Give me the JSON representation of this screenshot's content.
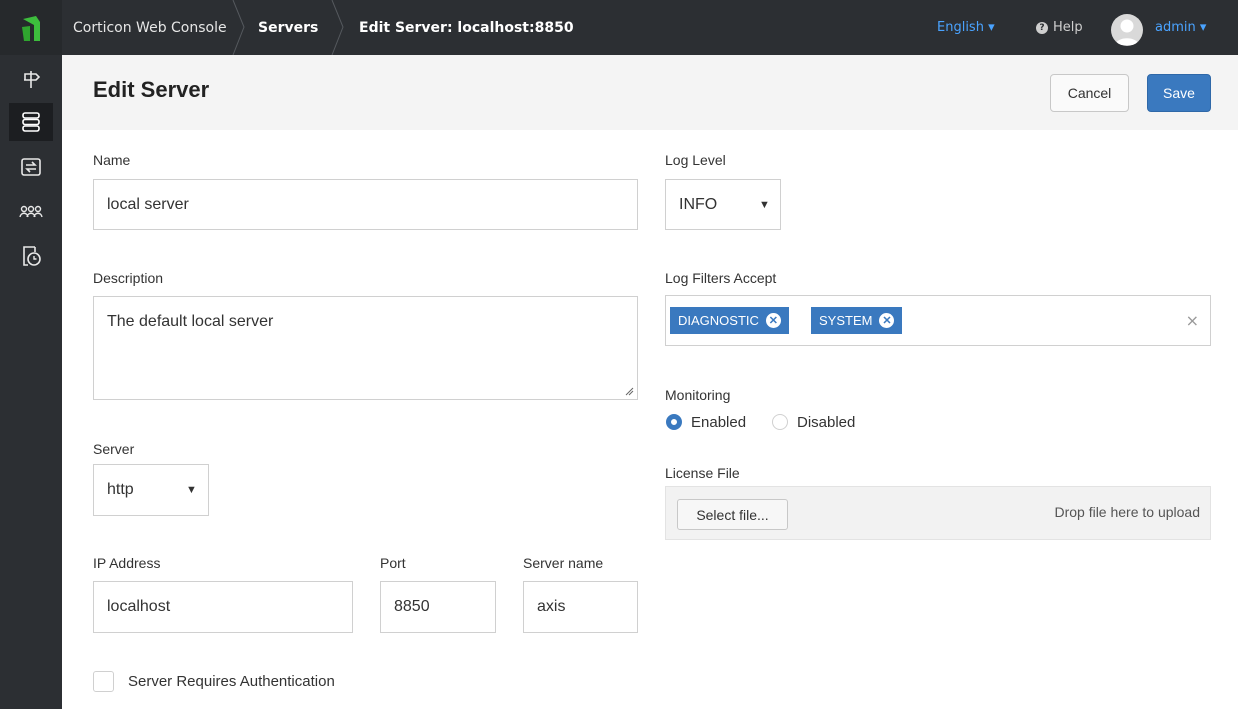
{
  "app": {
    "breadcrumbs": [
      "Corticon Web Console",
      "Servers",
      "Edit Server: localhost:8850"
    ],
    "language": "English ▾",
    "help": "Help",
    "user": "admin ▾"
  },
  "sidebar": {
    "items": [
      {
        "icon": "rule-project-icon",
        "active": false
      },
      {
        "icon": "servers-icon",
        "active": true
      },
      {
        "icon": "deployments-icon",
        "active": false
      },
      {
        "icon": "users-icon",
        "active": false
      },
      {
        "icon": "monitor-icon",
        "active": false
      }
    ]
  },
  "header": {
    "title": "Edit Server",
    "cancel_label": "Cancel",
    "save_label": "Save"
  },
  "form": {
    "name": {
      "label": "Name",
      "value": "local server"
    },
    "description": {
      "label": "Description",
      "value": "The default local server"
    },
    "server": {
      "label": "Server",
      "value": "http"
    },
    "ip": {
      "label": "IP Address",
      "value": "localhost"
    },
    "port": {
      "label": "Port",
      "value": "8850"
    },
    "server_name": {
      "label": "Server name",
      "value": "axis"
    },
    "auth": {
      "label": "Server Requires Authentication",
      "checked": false
    },
    "log_level": {
      "label": "Log Level",
      "value": "INFO"
    },
    "log_filters": {
      "label": "Log Filters Accept",
      "tags": [
        "DIAGNOSTIC",
        "SYSTEM"
      ],
      "clear": "×"
    },
    "monitoring": {
      "label": "Monitoring",
      "options": [
        "Enabled",
        "Disabled"
      ],
      "selected": "Enabled"
    },
    "license": {
      "label": "License File",
      "button": "Select file...",
      "drop_text": "Drop file here to upload"
    }
  },
  "colors": {
    "accent": "#3a79bf",
    "topbar": "#2c2f33",
    "logo_green": "#3dbd3d"
  }
}
